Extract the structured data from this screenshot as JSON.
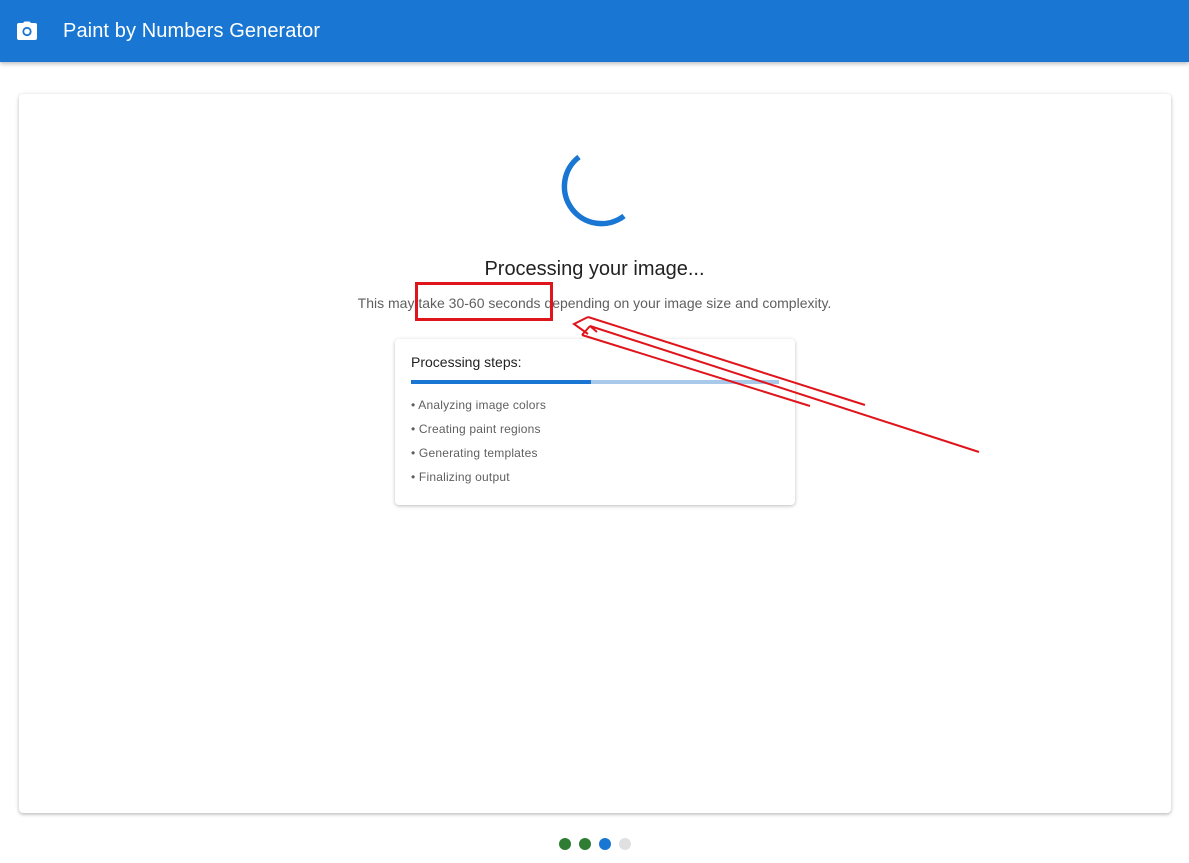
{
  "header": {
    "title": "Paint by Numbers Generator",
    "icon": "camera-icon",
    "color": "#1976d2"
  },
  "processing": {
    "title": "Processing your image...",
    "subtitle": "This may take 30-60 seconds depending on your image size and complexity."
  },
  "steps": {
    "title": "Processing steps:",
    "progress": 0.49,
    "items": [
      "• Analyzing image colors",
      "• Creating paint regions",
      "• Generating templates",
      "• Finalizing output"
    ]
  },
  "stepper_dots": [
    {
      "state": "complete",
      "color": "#2e7d32"
    },
    {
      "state": "complete",
      "color": "#2e7d32"
    },
    {
      "state": "active",
      "color": "#1976d2"
    },
    {
      "state": "pending",
      "color": "#e0e0e0"
    }
  ],
  "annotation": {
    "color": "#e0141b",
    "highlighted_text": "30-60 seconds"
  }
}
